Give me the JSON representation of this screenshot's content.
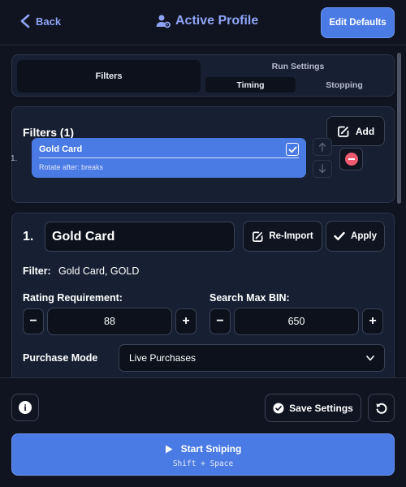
{
  "header": {
    "back_label": "Back",
    "title": "Active Profile",
    "edit_defaults_label": "Edit Defaults"
  },
  "tabs": {
    "filters_label": "Filters",
    "run_settings_label": "Run Settings",
    "timing_label": "Timing",
    "stopping_label": "Stopping"
  },
  "filters_panel": {
    "heading": "Filters (1)",
    "add_label": "Add",
    "items": [
      {
        "index": "1.",
        "name": "Gold Card",
        "subtitle": "Rotate after: breaks",
        "checked": true
      }
    ]
  },
  "editor": {
    "index": "1.",
    "name_value": "Gold Card",
    "reimport_label": "Re-Import",
    "apply_label": "Apply",
    "filter_label": "Filter:",
    "filter_value": "Gold Card, GOLD",
    "rating_label": "Rating Requirement:",
    "rating_value": "88",
    "max_bin_label": "Search Max BIN:",
    "max_bin_value": "650",
    "minus_symbol": "−",
    "plus_symbol": "+",
    "purchase_mode_label": "Purchase Mode",
    "purchase_mode_value": "Live Purchases"
  },
  "footer": {
    "info_symbol": "i",
    "save_settings_label": "Save Settings",
    "start_label": "Start Sniping",
    "start_hint": "Shift + Space"
  },
  "icons": {
    "back": "chevron-left-icon",
    "profile": "user-gear-icon",
    "add": "square-plus-icon",
    "check": "check-icon",
    "arrow_up": "arrow-up-icon",
    "arrow_down": "arrow-down-icon",
    "remove": "minus-circle-icon",
    "info": "info-icon",
    "save": "check-circle-icon",
    "reset": "rotate-icon",
    "play": "play-icon"
  },
  "colors": {
    "background": "#0f1420",
    "panel": "#172033",
    "accent": "#4a7be4",
    "accent_text": "#8fa4f5",
    "danger": "#ef5a6f"
  }
}
